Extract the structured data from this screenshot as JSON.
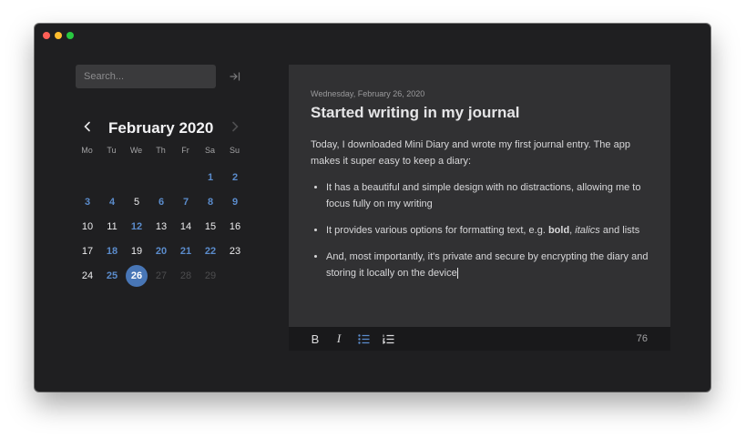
{
  "sidebar": {
    "search_placeholder": "Search...",
    "collapse_icon": "collapse-sidebar-icon",
    "calendar": {
      "month_label": "February 2020",
      "weekdays": [
        "Mo",
        "Tu",
        "We",
        "Th",
        "Fr",
        "Sa",
        "Su"
      ],
      "weeks": [
        [
          null,
          null,
          null,
          null,
          null,
          "1",
          "2"
        ],
        [
          "3",
          "4",
          "5",
          "6",
          "7",
          "8",
          "9"
        ],
        [
          "10",
          "11",
          "12",
          "13",
          "14",
          "15",
          "16"
        ],
        [
          "17",
          "18",
          "19",
          "20",
          "21",
          "22",
          "23"
        ],
        [
          "24",
          "25",
          "26",
          "27",
          "28",
          "29",
          null
        ]
      ],
      "entry_days": [
        "1",
        "2",
        "3",
        "4",
        "6",
        "7",
        "8",
        "9",
        "12",
        "18",
        "20",
        "21",
        "22",
        "25"
      ],
      "selected_day": "26",
      "future_days": [
        "27",
        "28",
        "29"
      ]
    }
  },
  "editor": {
    "date": "Wednesday, February 26, 2020",
    "title": "Started writing in my journal",
    "intro": "Today, I downloaded Mini Diary and wrote my first journal entry. The app makes it super easy to keep a diary:",
    "bullet1": "It has a beautiful and simple design with no distractions, allowing me to focus fully on my writing",
    "bullet2_prefix": "It provides various options for formatting text, e.g. ",
    "bullet2_bold": "bold",
    "bullet2_sep": ", ",
    "bullet2_italic": "italics",
    "bullet2_suffix": " and lists",
    "bullet3": "And, most importantly, it's private and secure by encrypting the diary and storing it locally on the device"
  },
  "toolbar": {
    "bold_label": "B",
    "italic_label": "I",
    "word_count": "76"
  },
  "colors": {
    "accent": "#5b8ccc",
    "selected": "#4876b6",
    "window_bg": "#1f1f21",
    "editor_bg": "#313133"
  }
}
